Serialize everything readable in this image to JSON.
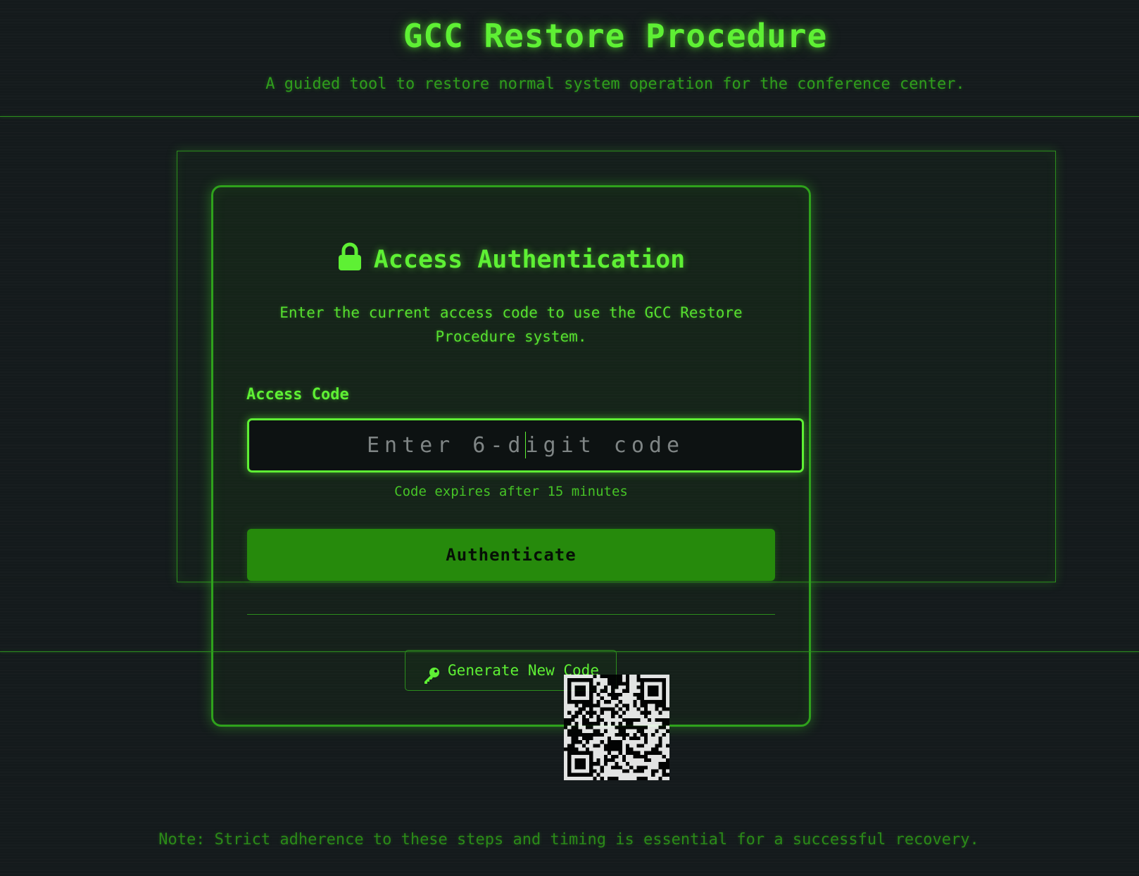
{
  "header": {
    "title": "GCC Restore Procedure",
    "subtitle": "A guided tool to restore normal system operation for the conference center."
  },
  "auth": {
    "heading": "Access Authentication",
    "description_line1": "Enter the current access code to use the GCC Restore",
    "description_line2": "Procedure system.",
    "code_label": "Access Code",
    "code_placeholder": "Enter 6-digit code",
    "code_value": "",
    "expiry_note": "Code expires after 15 minutes",
    "authenticate_label": "Authenticate",
    "generate_label": "Generate New Code"
  },
  "footer": {
    "note": "Note: Strict adherence to these steps and timing is essential for a successful recovery."
  },
  "icons": {
    "lock": "lock-icon",
    "key": "key-icon",
    "qr": "qr-code"
  },
  "colors": {
    "accent": "#5ef034",
    "button_bg": "#268a0c",
    "background": "#141a1c"
  }
}
